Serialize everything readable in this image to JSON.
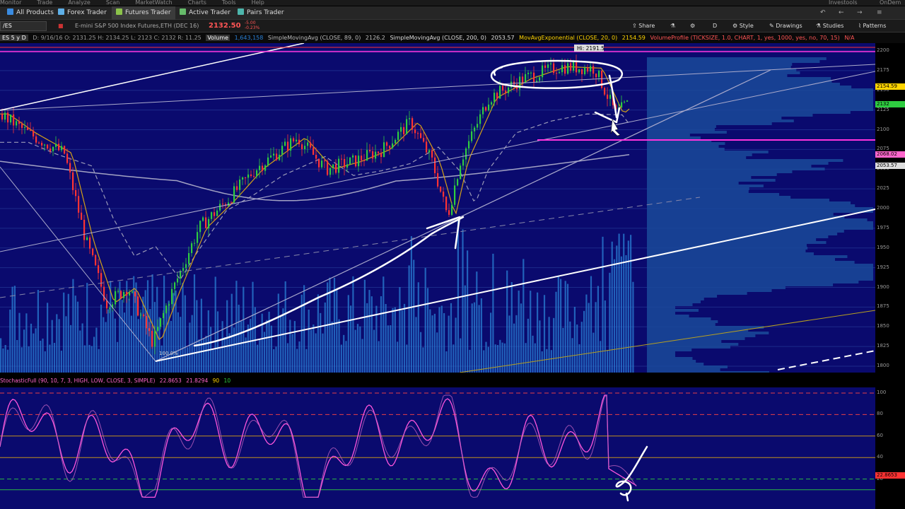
{
  "menubar": {
    "items": [
      "Monitor",
      "Trade",
      "Analyze",
      "Scan",
      "MarketWatch",
      "Charts",
      "Tools",
      "Help"
    ],
    "right": [
      "Investools",
      "OnDem"
    ]
  },
  "tabs": [
    {
      "label": "All Products",
      "icon": "grid-icon",
      "color": "#3a8be0"
    },
    {
      "label": "Forex Trader",
      "icon": "forex-icon",
      "color": "#5fb0e8"
    },
    {
      "label": "Futures Trader",
      "icon": "futures-icon",
      "color": "#8bc34a"
    },
    {
      "label": "Active Trader",
      "icon": "active-trader-icon",
      "color": "#66bb6a"
    },
    {
      "label": "Pairs Trader",
      "icon": "pairs-icon",
      "color": "#4db6ac"
    }
  ],
  "toolbar": {
    "symbol": "/ES",
    "description": "E-mini S&P 500 Index Futures,ETH (DEC 16)",
    "last_price": "2132.50",
    "change_top": "-5.00",
    "change_bottom": "-0.23%",
    "buttons": [
      "Share",
      "D",
      "Style",
      "Drawings",
      "Studies",
      "Patterns"
    ]
  },
  "studies": {
    "period": "ES 5 y D",
    "ohlc": "D: 9/16/16  O: 2131.25  H: 2134.25  L: 2123  C: 2132  R: 11.25",
    "volume_label": "Volume",
    "volume_value": "1,643,158",
    "sma89": "SimpleMovingAvg (CLOSE, 89, 0)",
    "sma89_value": "2126.2",
    "sma200": "SimpleMovingAvg (CLOSE, 200, 0)",
    "sma200_value": "2053.57",
    "ema20": "MovAvgExponential (CLOSE, 20, 0)",
    "ema20_value": "2154.59",
    "vprofile": "VolumeProfile (TICKSIZE, 1.0, CHART, 1, yes, 1000, yes, no, 70, 15)",
    "vprofile_value": "N/A"
  },
  "chart": {
    "high_label": "Hi: 2191.5",
    "trendline_pct": "100.0%",
    "price_ticks": [
      "2200",
      "2175",
      "2150",
      "2125",
      "2100",
      "2075",
      "2050",
      "2025",
      "2000",
      "1975",
      "1950",
      "1925",
      "1900",
      "1875",
      "1850",
      "1825",
      "1800"
    ],
    "price_labels": [
      {
        "text": "2154.59",
        "color": "#ffd400"
      },
      {
        "text": "2132",
        "color": "#2ecc40"
      },
      {
        "text": "2068.02",
        "color": "#ff66cc"
      },
      {
        "text": "2053.57",
        "color": "#dddddd"
      }
    ],
    "colors": {
      "background": "#0a0a6e",
      "up": "#2ecc40",
      "down": "#ff3333",
      "magenta": "#ff33dd",
      "ema": "#d4a017",
      "volume": "#2a7fd4"
    }
  },
  "stochastic": {
    "header": "StochasticFull (90, 10, 7, 3, HIGH, LOW, CLOSE, 3, SIMPLE)",
    "k_value": "22.8653",
    "d_value": "21.8294",
    "ob": "90",
    "os": "10",
    "ticks": [
      "100",
      "80",
      "60",
      "40",
      "20"
    ],
    "current_label": "22.8653"
  }
}
